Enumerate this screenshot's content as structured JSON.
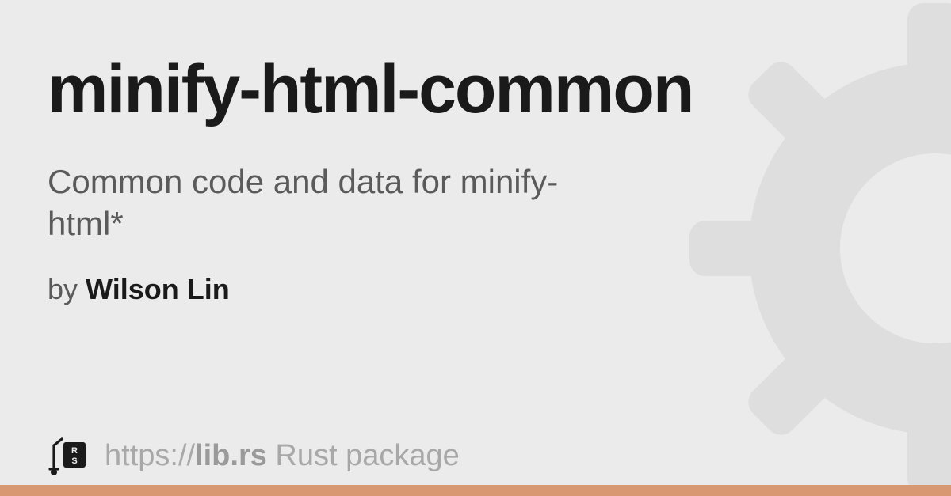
{
  "package": {
    "name": "minify-html-common",
    "description": "Common code and data for minify-html*",
    "author_prefix": "by ",
    "author_name": "Wilson Lin"
  },
  "footer": {
    "url_prefix": "https://",
    "url_domain": "lib.rs",
    "url_suffix": " Rust package"
  },
  "colors": {
    "accent": "#d89872"
  }
}
